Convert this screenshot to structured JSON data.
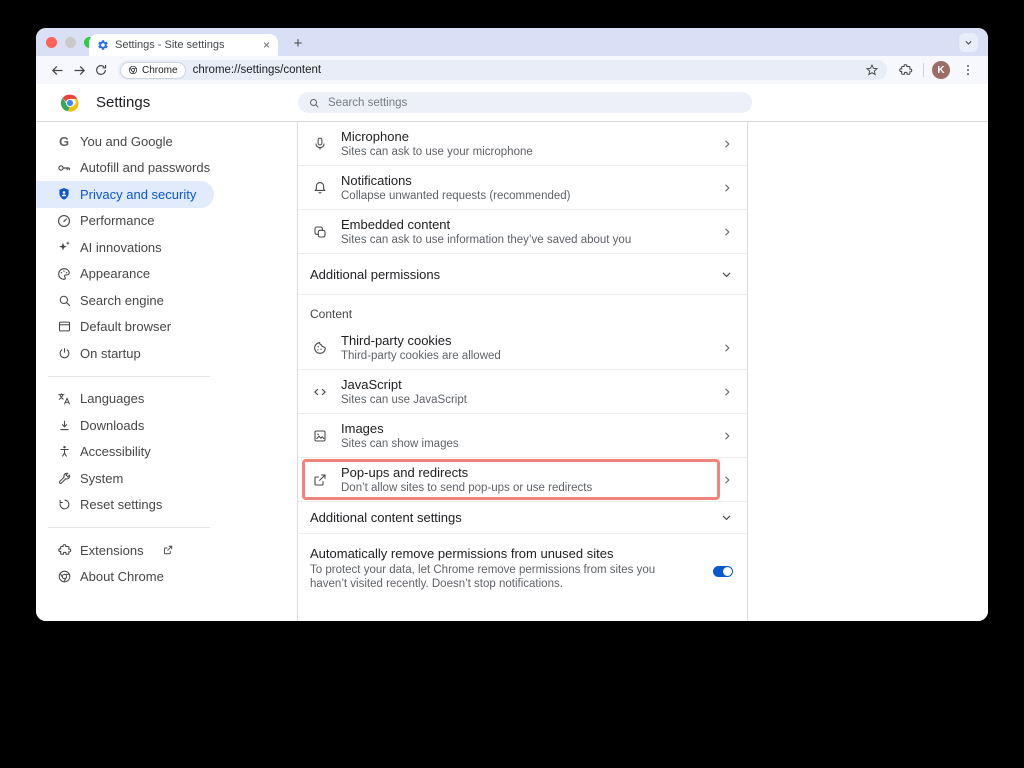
{
  "tab_bar": {
    "active_tab_title": "Settings - Site settings",
    "close_glyph": "×",
    "new_tab_glyph": "+"
  },
  "toolbar": {
    "site_chip_label": "Chrome",
    "url": "chrome://settings/content",
    "avatar_initial": "K"
  },
  "header": {
    "title": "Settings",
    "search_placeholder": "Search settings"
  },
  "sidebar": {
    "groups": [
      {
        "items": [
          {
            "label": "You and Google",
            "icon": "google-g-icon"
          },
          {
            "label": "Autofill and passwords",
            "icon": "key-icon"
          },
          {
            "label": "Privacy and security",
            "icon": "shield-icon",
            "selected": true
          },
          {
            "label": "Performance",
            "icon": "speedometer-icon"
          },
          {
            "label": "AI innovations",
            "icon": "sparkle-icon"
          },
          {
            "label": "Appearance",
            "icon": "palette-icon"
          },
          {
            "label": "Search engine",
            "icon": "magnifier-icon"
          },
          {
            "label": "Default browser",
            "icon": "browser-window-icon"
          },
          {
            "label": "On startup",
            "icon": "power-icon"
          }
        ]
      },
      {
        "items": [
          {
            "label": "Languages",
            "icon": "translate-icon"
          },
          {
            "label": "Downloads",
            "icon": "download-icon"
          },
          {
            "label": "Accessibility",
            "icon": "accessibility-icon"
          },
          {
            "label": "System",
            "icon": "wrench-icon"
          },
          {
            "label": "Reset settings",
            "icon": "reset-icon"
          }
        ]
      },
      {
        "items": [
          {
            "label": "Extensions",
            "icon": "puzzle-icon",
            "external": true
          },
          {
            "label": "About Chrome",
            "icon": "chrome-mono-icon"
          }
        ]
      }
    ]
  },
  "main": {
    "permission_rows": [
      {
        "title": "Microphone",
        "subtitle": "Sites can ask to use your microphone",
        "icon": "microphone-icon"
      },
      {
        "title": "Notifications",
        "subtitle": "Collapse unwanted requests (recommended)",
        "icon": "bell-icon"
      },
      {
        "title": "Embedded content",
        "subtitle": "Sites can ask to use information they’ve saved about you",
        "icon": "embedded-content-icon"
      }
    ],
    "additional_permissions_label": "Additional permissions",
    "content_section_label": "Content",
    "content_rows": [
      {
        "title": "Third-party cookies",
        "subtitle": "Third-party cookies are allowed",
        "icon": "cookie-icon"
      },
      {
        "title": "JavaScript",
        "subtitle": "Sites can use JavaScript",
        "icon": "code-icon"
      },
      {
        "title": "Images",
        "subtitle": "Sites can show images",
        "icon": "image-icon"
      },
      {
        "title": "Pop-ups and redirects",
        "subtitle": "Don’t allow sites to send pop-ups or use redirects",
        "icon": "open-in-new-icon",
        "highlighted": true
      }
    ],
    "additional_content_label": "Additional content settings",
    "unused_sites": {
      "title": "Automatically remove permissions from unused sites",
      "description": "To protect your data, let Chrome remove permissions from sites you haven’t visited recently. Doesn’t stop notifications.",
      "toggle_on": true
    }
  },
  "colors": {
    "accent_blue": "#0b57d0",
    "highlight_border": "#f0837b",
    "toggle_on": "#0b57d0",
    "tabstrip_bg": "#d9dff4",
    "selected_nav_bg": "#e1ebfc"
  }
}
